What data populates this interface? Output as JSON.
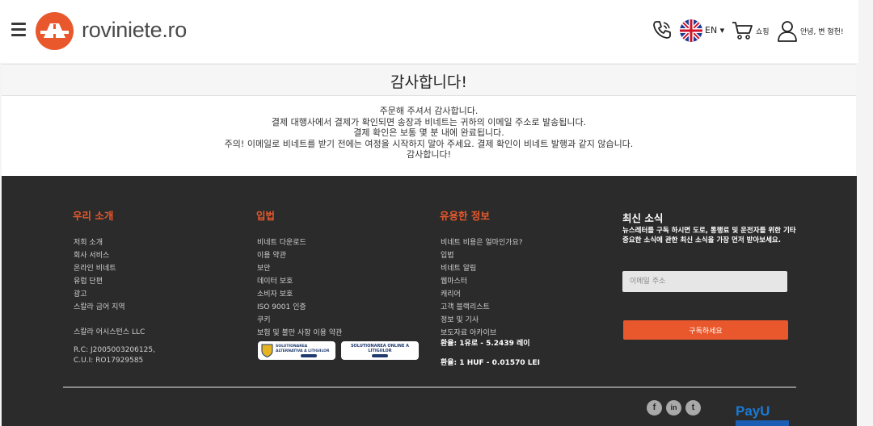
{
  "header": {
    "logo_text": "roviniete.ro",
    "lang": "EN ▾",
    "cart_label": "쇼핑",
    "greeting": "안녕, 변 형헌!"
  },
  "thanks": {
    "title": "감사합니다!",
    "lines": [
      "주문해 주셔서 감사합니다.",
      "결제 대행사에서 결제가 확인되면 송장과 비네트는 귀하의 이메일 주소로 발송됩니다.",
      "결제 확인은 보통 몇 분 내에 완료됩니다.",
      "주의! 이메일로 비네트를 받기 전에는 여정을 시작하지 말아 주세요. 결제 확인이 비네트 발행과 같지 않습니다.",
      "감사합니다!"
    ]
  },
  "footer": {
    "about": {
      "title": "우리 소개",
      "links": [
        "저희 소개",
        "회사 서비스",
        "온라인 비네트",
        "유럽 단편",
        "광고",
        "스칼라 금어 지역"
      ],
      "company_name": "스칼라 어시스턴스 LLC",
      "company_reg_1": "R.C: J2005003206125,",
      "company_reg_2": "C.U.I: RO17929585"
    },
    "legal": {
      "title": "입법",
      "links": [
        "비네트 다운로드",
        "이용 약관",
        "보안",
        "데이터 보호",
        "소비자 보호",
        "ISO 9001 인증",
        "쿠키",
        "보험 및 불만 사항 이용 약관"
      ],
      "badge_anpc": "ANPC",
      "badge_sol": "SOLUTIONAREA ALTERNATIVA A LITIGIILOR",
      "badge_online": "SOLUTIONAREA ONLINE A LITIGIILOR"
    },
    "info": {
      "title": "유용한 정보",
      "links": [
        "비네트 비용은 얼마인가요?",
        "입법",
        "비네트 알림",
        "웹마스터",
        "캐리어",
        "고객 블랙리스트",
        "정보 및 기사",
        "보도자료 아카이브"
      ],
      "rate_eur": "환율: 1유로 - 5.2439 레이",
      "rate_huf": "환율: 1 HUF - 0.01570 LEI"
    },
    "news": {
      "title": "최신 소식",
      "subtitle": "뉴스레터를 구독 하시면 도로, 통행료 및 운전자를 위한 기타 중요한 소식에 관한 최신 소식을 가장 먼저 받아보세요.",
      "email_placeholder": "이메일 주소",
      "subscribe_label": "구독하세요"
    },
    "social": {
      "fb": "f",
      "in": "in",
      "tw": "t"
    },
    "payu": "PayU"
  },
  "colors": {
    "accent": "#e8582c",
    "footer_bg": "#2b2b2b"
  },
  "icons": [
    "menu-icon",
    "logo-icon",
    "phone-icon",
    "uk-flag-icon",
    "cart-icon",
    "user-icon",
    "facebook-icon",
    "linkedin-icon",
    "twitter-icon"
  ]
}
